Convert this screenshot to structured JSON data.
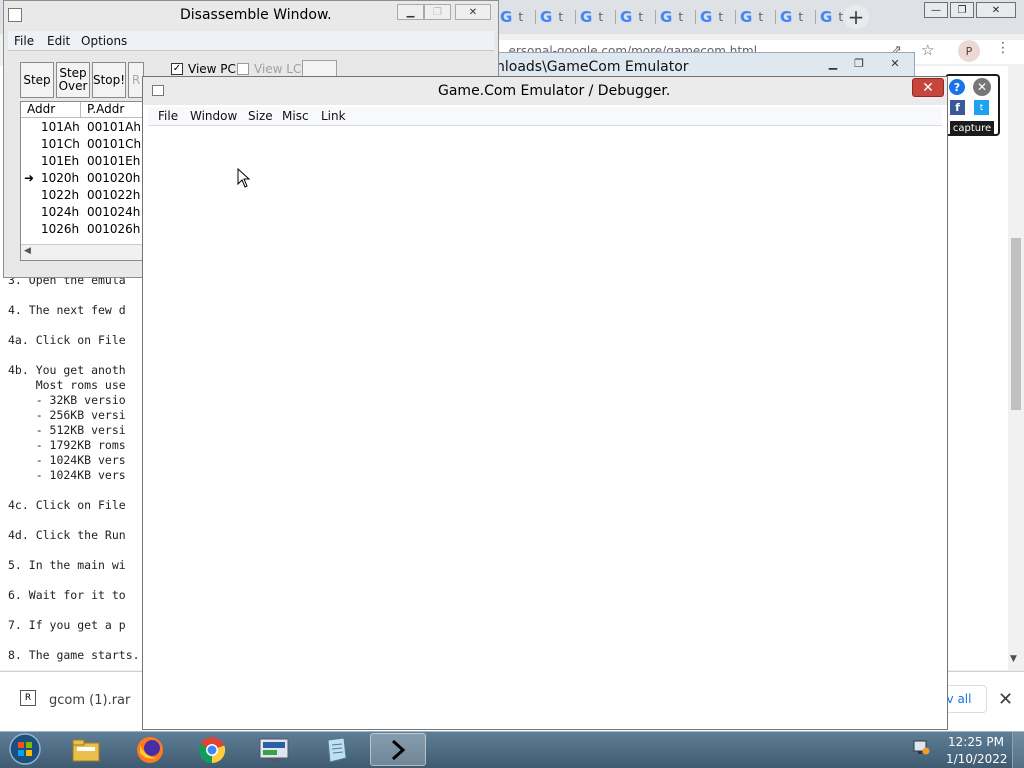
{
  "browser": {
    "tabs": [
      "t",
      "t",
      "t",
      "t",
      "t",
      "t",
      "t",
      "t",
      "t"
    ],
    "tab_glyph": "G",
    "new_tab": "+",
    "address": "...ersonal-google.com/more/gamecom.html",
    "avatar_initial": "P"
  },
  "page_text": {
    "lines": [
      "3. Open the emula",
      "",
      "4. The next few d",
      "",
      "4a. Click on File",
      "",
      "4b. You get anoth",
      "    Most roms use",
      "    - 32KB versio",
      "    - 256KB versi",
      "    - 512KB versi",
      "    - 1792KB roms",
      "    - 1024KB vers",
      "    - 1024KB vers",
      "",
      "4c. Click on File",
      "",
      "4d. Click the Run",
      "",
      "5. In the main wi",
      "",
      "6. Wait for it to",
      "",
      "7. If you get a p",
      "",
      "8. The game starts."
    ]
  },
  "widget": {
    "capture": "capture",
    "help": "?",
    "fb": "f",
    "tw": "t"
  },
  "download": {
    "filename": "gcom (1).rar",
    "show_all": "v all",
    "close": "✕",
    "icon": "R"
  },
  "folder_window": {
    "title": "nloads\\GameCom Emulator"
  },
  "disassemble": {
    "title": "Disassemble Window.",
    "menu": [
      "File",
      "Edit",
      "Options"
    ],
    "buttons": {
      "step": "Step",
      "step_over_1": "Step",
      "step_over_2": "Over",
      "stop": "Stop!",
      "partial": "R"
    },
    "view_pc": "View PC",
    "view_lc": "View LC",
    "columns": [
      "Addr",
      "P.Addr"
    ],
    "rows": [
      {
        "addr": "101Ah",
        "paddr": "00101Ah",
        "current": false
      },
      {
        "addr": "101Ch",
        "paddr": "00101Ch",
        "current": false
      },
      {
        "addr": "101Eh",
        "paddr": "00101Eh",
        "current": false
      },
      {
        "addr": "1020h",
        "paddr": "001020h",
        "current": true
      },
      {
        "addr": "1022h",
        "paddr": "001022h",
        "current": false
      },
      {
        "addr": "1024h",
        "paddr": "001024h",
        "current": false
      },
      {
        "addr": "1026h",
        "paddr": "001026h",
        "current": false
      }
    ]
  },
  "debugger": {
    "title": "Game.Com Emulator / Debugger.",
    "close": "✕",
    "menu": [
      "File",
      "Window",
      "Size",
      "Misc",
      "Link"
    ]
  },
  "taskbar": {
    "items": [
      "explorer",
      "firefox",
      "chrome",
      "monitor",
      "notepad",
      "terminal"
    ],
    "active": "terminal",
    "time": "12:25 PM",
    "date": "1/10/2022"
  }
}
